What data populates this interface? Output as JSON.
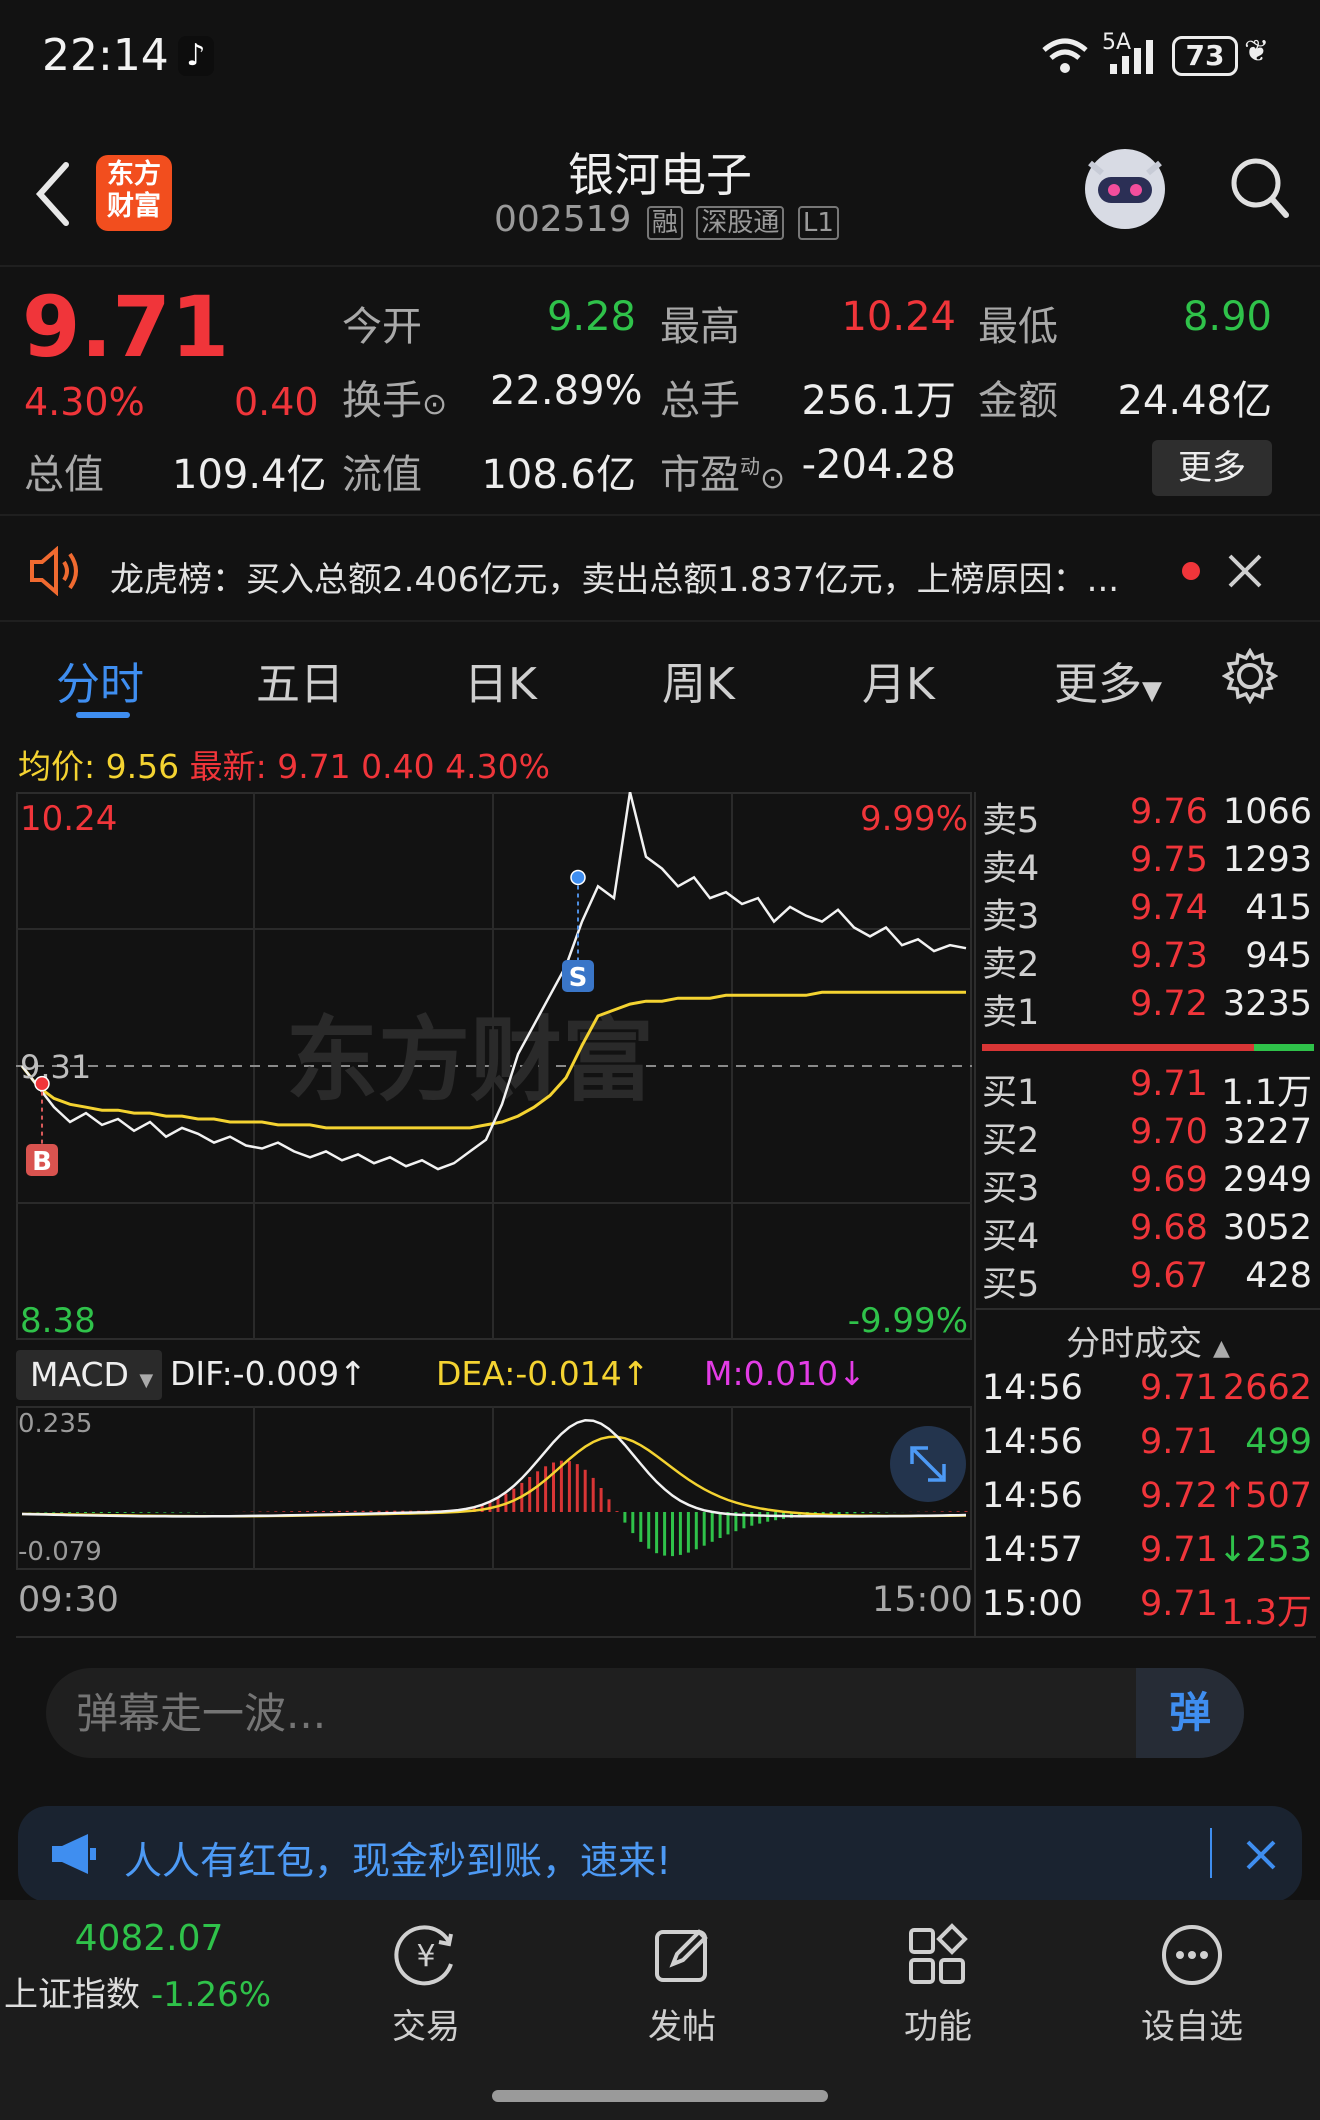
{
  "status_bar": {
    "time": "22:14",
    "network": "5A",
    "battery": "73"
  },
  "header": {
    "logo_line1": "东方",
    "logo_line2": "财富",
    "title": "银河电子",
    "code": "002519",
    "tag_rong": "融",
    "tag_market": "深股通",
    "tag_level": "L1"
  },
  "quote": {
    "price": "9.71",
    "change_pct": "4.30%",
    "change": "0.40",
    "open_label": "今开",
    "open": "9.28",
    "high_label": "最高",
    "high": "10.24",
    "low_label": "最低",
    "low": "8.90",
    "turnover_label": "换手",
    "turnover": "22.89%",
    "volume_label": "总手",
    "volume": "256.1万",
    "amount_label": "金额",
    "amount": "24.48亿",
    "mktcap_label": "总值",
    "mktcap": "109.4亿",
    "float_label": "流值",
    "float": "108.6亿",
    "pe_label": "市盈",
    "pe_sup": "动",
    "pe": "-204.28",
    "more_button": "更多"
  },
  "notice": {
    "text": "龙虎榜：买入总额2.406亿元，卖出总额1.837亿元，上榜原因：..."
  },
  "tabs": [
    "分时",
    "五日",
    "日K",
    "周K",
    "月K",
    "更多"
  ],
  "chart_legend": {
    "avg_label": "均价: 9.56",
    "latest_label": "最新: 9.71 0.40 4.30%"
  },
  "chart_data": {
    "type": "line",
    "title": "",
    "xlabel": "",
    "ylabel": "",
    "y_max_label": "10.24",
    "y_min_label": "8.38",
    "y_ref_label": "9.31",
    "pct_max_label": "9.99%",
    "pct_min_label": "-9.99%",
    "x_start": "09:30",
    "x_end": "15:00",
    "ylim": [
      8.38,
      10.24
    ],
    "prev_close": 9.31,
    "series": [
      {
        "name": "",
        "values": [
          9.31,
          9.24,
          9.17,
          9.12,
          9.15,
          9.11,
          9.13,
          9.09,
          9.12,
          9.07,
          9.1,
          9.08,
          9.05,
          9.07,
          9.04,
          9.03,
          9.05,
          9.02,
          9.0,
          9.02,
          8.99,
          9.01,
          8.98,
          9.0,
          8.97,
          8.99,
          8.96,
          8.98,
          9.02,
          9.06,
          9.18,
          9.35,
          9.45,
          9.55,
          9.65,
          9.8,
          9.92,
          9.88,
          10.24,
          10.02,
          9.98,
          9.92,
          9.95,
          9.88,
          9.9,
          9.86,
          9.88,
          9.8,
          9.85,
          9.82,
          9.8,
          9.84,
          9.78,
          9.75,
          9.78,
          9.72,
          9.74,
          9.7,
          9.72,
          9.71
        ]
      },
      {
        "name": "均价",
        "values": [
          9.31,
          9.24,
          9.2,
          9.18,
          9.17,
          9.16,
          9.16,
          9.15,
          9.15,
          9.14,
          9.14,
          9.13,
          9.13,
          9.12,
          9.12,
          9.12,
          9.11,
          9.11,
          9.11,
          9.1,
          9.1,
          9.1,
          9.1,
          9.1,
          9.1,
          9.1,
          9.1,
          9.1,
          9.1,
          9.11,
          9.12,
          9.14,
          9.17,
          9.21,
          9.27,
          9.38,
          9.48,
          9.5,
          9.52,
          9.53,
          9.53,
          9.54,
          9.54,
          9.54,
          9.55,
          9.55,
          9.55,
          9.55,
          9.55,
          9.55,
          9.56,
          9.56,
          9.56,
          9.56,
          9.56,
          9.56,
          9.56,
          9.56,
          9.56,
          9.56
        ]
      }
    ],
    "markers": [
      {
        "label": "B",
        "value": 9.25
      },
      {
        "label": "S",
        "value": 9.95
      }
    ]
  },
  "macd": {
    "selector": "MACD",
    "dif": "DIF:-0.009↑",
    "dea": "DEA:-0.014↑",
    "m": "M:0.010↓",
    "top_label": "0.235",
    "bottom_label": "-0.079"
  },
  "orderbook": {
    "asks": [
      {
        "label": "卖5",
        "price": "9.76",
        "vol": "1066"
      },
      {
        "label": "卖4",
        "price": "9.75",
        "vol": "1293"
      },
      {
        "label": "卖3",
        "price": "9.74",
        "vol": "415"
      },
      {
        "label": "卖2",
        "price": "9.73",
        "vol": "945"
      },
      {
        "label": "卖1",
        "price": "9.72",
        "vol": "3235"
      }
    ],
    "bids": [
      {
        "label": "买1",
        "price": "9.71",
        "vol": "1.1万"
      },
      {
        "label": "买2",
        "price": "9.70",
        "vol": "3227"
      },
      {
        "label": "买3",
        "price": "9.69",
        "vol": "2949"
      },
      {
        "label": "买4",
        "price": "9.68",
        "vol": "3052"
      },
      {
        "label": "买5",
        "price": "9.67",
        "vol": "428"
      }
    ],
    "buy_ratio": 0.82
  },
  "ticks": {
    "title": "分时成交",
    "rows": [
      {
        "time": "14:56",
        "price": "9.71",
        "vol": "2662",
        "dir": "",
        "color": "red"
      },
      {
        "time": "14:56",
        "price": "9.71",
        "vol": "499",
        "dir": "",
        "color": "green"
      },
      {
        "time": "14:56",
        "price": "9.72",
        "vol": "507",
        "dir": "↑",
        "color": "red"
      },
      {
        "time": "14:57",
        "price": "9.71",
        "vol": "253",
        "dir": "↓",
        "color": "green"
      },
      {
        "time": "15:00",
        "price": "9.71",
        "vol": "1.3万",
        "dir": "",
        "color": "red"
      }
    ]
  },
  "danmu": {
    "placeholder": "弹幕走一波...",
    "send_label": "弹"
  },
  "promo": {
    "text": "人人有红包，现金秒到账，速来!"
  },
  "bottom_nav": {
    "index_value": "4082.07",
    "index_name": "上证指数",
    "index_change": "-1.26%",
    "items": [
      "交易",
      "发帖",
      "功能",
      "设自选"
    ]
  },
  "colors": {
    "up": "#f0353a",
    "down": "#2fc24a",
    "avg": "#f4d331",
    "accent": "#3f8ef0"
  }
}
